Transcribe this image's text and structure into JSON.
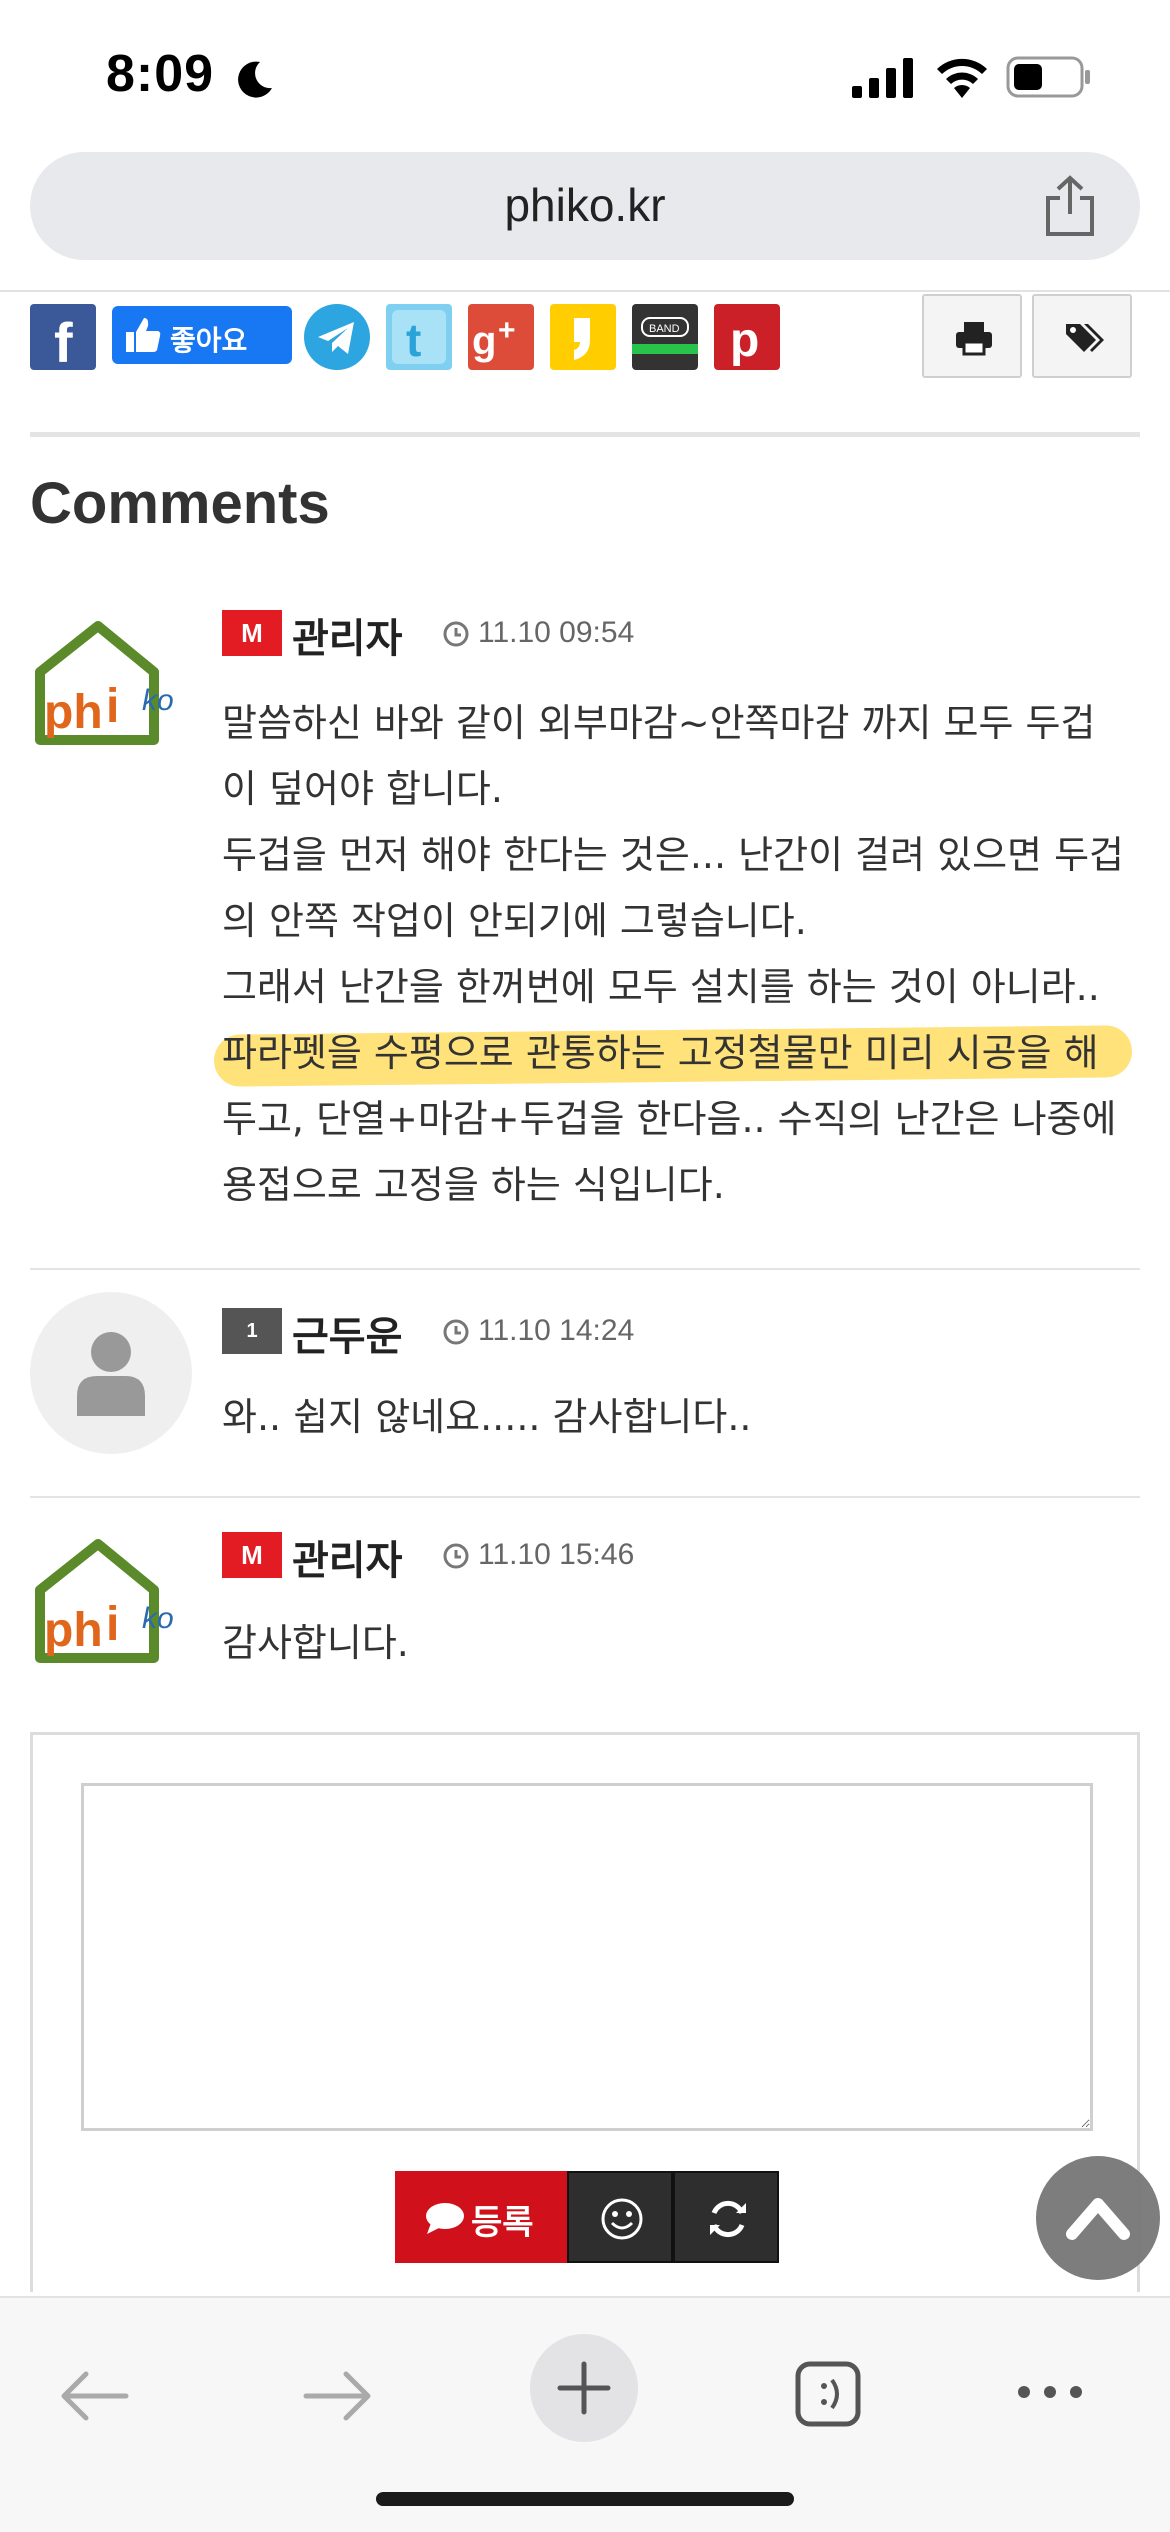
{
  "status_bar": {
    "time": "8:09"
  },
  "browser": {
    "url": "phiko.kr"
  },
  "social": {
    "like_label": "좋아요",
    "icons": [
      "facebook-icon",
      "facebook-like-button",
      "telegram-icon",
      "twitter-icon",
      "google-plus-icon",
      "kakaostory-icon",
      "band-icon",
      "pinterest-icon"
    ],
    "band_label": "BAND"
  },
  "comments_section": {
    "title": "Comments",
    "items": [
      {
        "badge": "M",
        "author": "관리자",
        "time": "11.10 09:54",
        "lines": [
          "말씀하신 바와 같이 외부마감~안쪽마감 까지 모두 두겁",
          "이 덮어야 합니다.",
          "두겁을 먼저 해야 한다는 것은... 난간이 걸려 있으면 두겁",
          "의 안쪽 작업이 안되기에 그렇습니다.",
          "그래서 난간을 한꺼번에 모두 설치를 하는 것이 아니라..",
          "파라펫을 수평으로 관통하는 고정철물만 미리 시공을 해",
          "두고, 단열+마감+두겁을 한다음.. 수직의 난간은 나중에",
          "용접으로 고정을 하는 식입니다."
        ]
      },
      {
        "badge": "1",
        "author": "근두운",
        "time": "11.10 14:24",
        "lines": [
          "와.. 쉽지 않네요..... 감사합니다.."
        ]
      },
      {
        "badge": "M",
        "author": "관리자",
        "time": "11.10 15:46",
        "lines": [
          "감사합니다."
        ]
      }
    ],
    "logo_text": {
      "ph": "ph",
      "i": "i",
      "ko": "ko"
    }
  },
  "comment_form": {
    "submit_label": "등록",
    "textarea_value": ""
  },
  "colors": {
    "admin_badge": "#e31b23",
    "submit": "#d0111b",
    "highlight": "#ffe27a",
    "facebook": "#3b5998",
    "like": "#1877f2"
  }
}
